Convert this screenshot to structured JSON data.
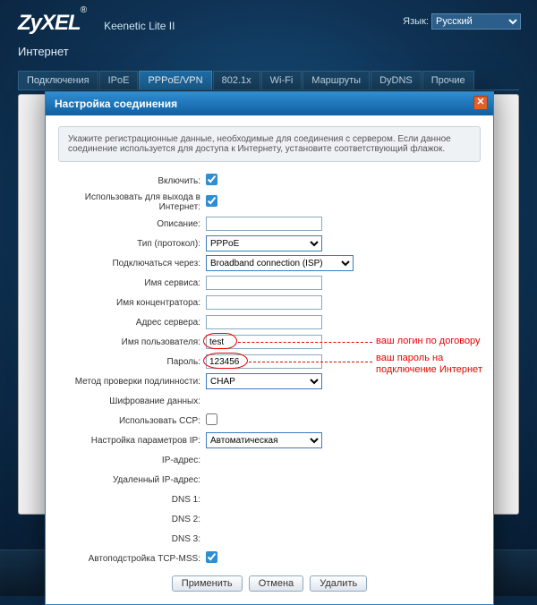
{
  "header": {
    "brand": "ZyXEL",
    "model": "Keenetic Lite II",
    "section": "Интернет",
    "lang_label": "Язык:",
    "lang_value": "Русский"
  },
  "tabs": [
    {
      "label": "Подключения"
    },
    {
      "label": "IPoE"
    },
    {
      "label": "PPPoE/VPN"
    },
    {
      "label": "802.1x"
    },
    {
      "label": "Wi-Fi"
    },
    {
      "label": "Маршруты"
    },
    {
      "label": "DyDNS"
    },
    {
      "label": "Прочие"
    }
  ],
  "modal": {
    "title": "Настройка соединения",
    "info": "Укажите регистрационные данные, необходимые для соединения с сервером. Если данное соединение используется для доступа к Интернету, установите соответствующий флажок.",
    "fields": {
      "enable": {
        "label": "Включить:",
        "checked": true
      },
      "use_internet": {
        "label": "Использовать для выхода в Интернет:",
        "checked": true
      },
      "description": {
        "label": "Описание:",
        "value": ""
      },
      "proto": {
        "label": "Тип (протокол):",
        "value": "PPPoE"
      },
      "via": {
        "label": "Подключаться через:",
        "value": "Broadband connection (ISP)"
      },
      "service": {
        "label": "Имя сервиса:",
        "value": ""
      },
      "concentrator": {
        "label": "Имя концентратора:",
        "value": ""
      },
      "server": {
        "label": "Адрес сервера:",
        "value": ""
      },
      "user": {
        "label": "Имя пользователя:",
        "value": "test"
      },
      "pass": {
        "label": "Пароль:",
        "value": "123456"
      },
      "auth": {
        "label": "Метод проверки подлинности:",
        "value": "CHAP"
      },
      "encrypt": {
        "label": "Шифрование данных:",
        "value": ""
      },
      "ccp": {
        "label": "Использовать CCP:",
        "checked": false
      },
      "ipcfg": {
        "label": "Настройка параметров IP:",
        "value": "Автоматическая"
      },
      "ip": {
        "label": "IP-адрес:",
        "value": ""
      },
      "remote_ip": {
        "label": "Удаленный IP-адрес:",
        "value": ""
      },
      "dns1": {
        "label": "DNS 1:",
        "value": ""
      },
      "dns2": {
        "label": "DNS 2:",
        "value": ""
      },
      "dns3": {
        "label": "DNS 3:",
        "value": ""
      },
      "tcpmss": {
        "label": "Автоподстройка TCP-MSS:",
        "checked": true
      }
    },
    "buttons": {
      "apply": "Применить",
      "cancel": "Отмена",
      "delete": "Удалить"
    }
  },
  "annotations": {
    "login": "ваш логин по договору",
    "password": "ваш пароль на подключение Интернет"
  }
}
